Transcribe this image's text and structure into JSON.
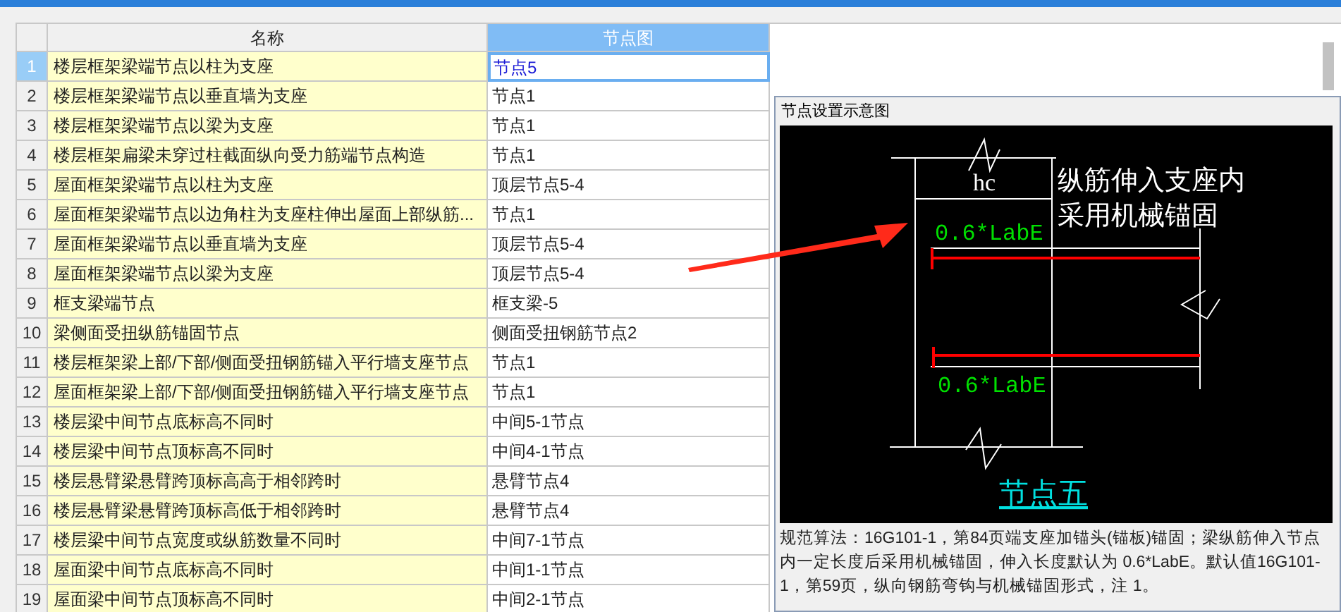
{
  "table": {
    "columns": [
      "名称",
      "节点图"
    ],
    "rows": [
      {
        "number": "1",
        "name": "楼层框架梁端节点以柱为支座",
        "node": "节点5",
        "selected": true
      },
      {
        "number": "2",
        "name": "楼层框架梁端节点以垂直墙为支座",
        "node": "节点1",
        "selected": false
      },
      {
        "number": "3",
        "name": "楼层框架梁端节点以梁为支座",
        "node": "节点1",
        "selected": false
      },
      {
        "number": "4",
        "name": "楼层框架扁梁未穿过柱截面纵向受力筋端节点构造",
        "node": "节点1",
        "selected": false
      },
      {
        "number": "5",
        "name": "屋面框架梁端节点以柱为支座",
        "node": "顶层节点5-4",
        "selected": false
      },
      {
        "number": "6",
        "name": "屋面框架梁端节点以边角柱为支座柱伸出屋面上部纵筋...",
        "node": "节点1",
        "selected": false
      },
      {
        "number": "7",
        "name": "屋面框架梁端节点以垂直墙为支座",
        "node": "顶层节点5-4",
        "selected": false
      },
      {
        "number": "8",
        "name": "屋面框架梁端节点以梁为支座",
        "node": "顶层节点5-4",
        "selected": false
      },
      {
        "number": "9",
        "name": "框支梁端节点",
        "node": "框支梁-5",
        "selected": false
      },
      {
        "number": "10",
        "name": "梁侧面受扭纵筋锚固节点",
        "node": "侧面受扭钢筋节点2",
        "selected": false
      },
      {
        "number": "11",
        "name": "楼层框架梁上部/下部/侧面受扭钢筋锚入平行墙支座节点",
        "node": "节点1",
        "selected": false
      },
      {
        "number": "12",
        "name": "屋面框架梁上部/下部/侧面受扭钢筋锚入平行墙支座节点",
        "node": "节点1",
        "selected": false
      },
      {
        "number": "13",
        "name": "楼层梁中间节点底标高不同时",
        "node": "中间5-1节点",
        "selected": false
      },
      {
        "number": "14",
        "name": "楼层梁中间节点顶标高不同时",
        "node": "中间4-1节点",
        "selected": false
      },
      {
        "number": "15",
        "name": "楼层悬臂梁悬臂跨顶标高高于相邻跨时",
        "node": "悬臂节点4",
        "selected": false
      },
      {
        "number": "16",
        "name": "楼层悬臂梁悬臂跨顶标高低于相邻跨时",
        "node": "悬臂节点4",
        "selected": false
      },
      {
        "number": "17",
        "name": "楼层梁中间节点宽度或纵筋数量不同时",
        "node": "中间7-1节点",
        "selected": false
      },
      {
        "number": "18",
        "name": "屋面梁中间节点底标高不同时",
        "node": "中间1-1节点",
        "selected": false
      },
      {
        "number": "19",
        "name": "屋面梁中间节点顶标高不同时",
        "node": "中间2-1节点",
        "selected": false
      }
    ]
  },
  "node_panel": {
    "title": "节点设置示意图",
    "diagram": {
      "dimension_label": "hc",
      "note_lines": [
        "纵筋伸入支座内",
        "采用机械锚固"
      ],
      "anchor_labels": [
        "0.6*LabE",
        "0.6*LabE"
      ],
      "caption": "节点五"
    },
    "description": "规范算法：16G101-1，第84页端支座加锚头(锚板)锚固；梁纵筋伸入节点内一定长度后采用机械锚固，伸入长度默认为 0.6*LabE。默认值16G101-1，第59页，纵向钢筋弯钩与机械锚固形式，注 1。"
  }
}
